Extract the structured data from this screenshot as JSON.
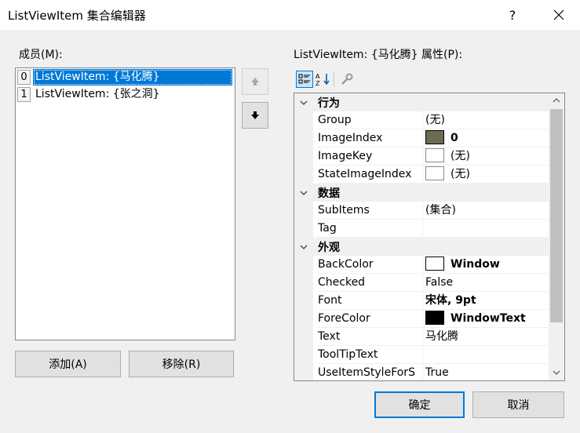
{
  "window": {
    "title": "ListViewItem 集合编辑器",
    "help_label": "?"
  },
  "members": {
    "label": "成员(M):",
    "items": [
      {
        "index": "0",
        "text": "ListViewItem: {马化腾}",
        "selected": true
      },
      {
        "index": "1",
        "text": "ListViewItem: {张之洞}",
        "selected": false
      }
    ]
  },
  "buttons": {
    "add": "添加(A)",
    "remove": "移除(R)",
    "ok": "确定",
    "cancel": "取消"
  },
  "properties": {
    "label": "ListViewItem: {马化腾} 属性(P):",
    "categories": [
      {
        "name": "行为",
        "rows": [
          {
            "name": "Group",
            "value": "(无)"
          },
          {
            "name": "ImageIndex",
            "value": "0"
          },
          {
            "name": "ImageKey",
            "value": "(无)"
          },
          {
            "name": "StateImageIndex",
            "value": "(无)"
          }
        ]
      },
      {
        "name": "数据",
        "rows": [
          {
            "name": "SubItems",
            "value": "(集合)"
          },
          {
            "name": "Tag",
            "value": ""
          }
        ]
      },
      {
        "name": "外观",
        "rows": [
          {
            "name": "BackColor",
            "value": "Window"
          },
          {
            "name": "Checked",
            "value": "False"
          },
          {
            "name": "Font",
            "value": "宋体, 9pt"
          },
          {
            "name": "ForeColor",
            "value": "WindowText"
          },
          {
            "name": "Text",
            "value": "马化腾"
          },
          {
            "name": "ToolTipText",
            "value": ""
          },
          {
            "name": "UseItemStyleForS",
            "value": "True"
          }
        ]
      }
    ]
  },
  "colors": {
    "selection": "#0078d7",
    "backcolor_swatch": "#ffffff",
    "forecolor_swatch": "#000000"
  }
}
